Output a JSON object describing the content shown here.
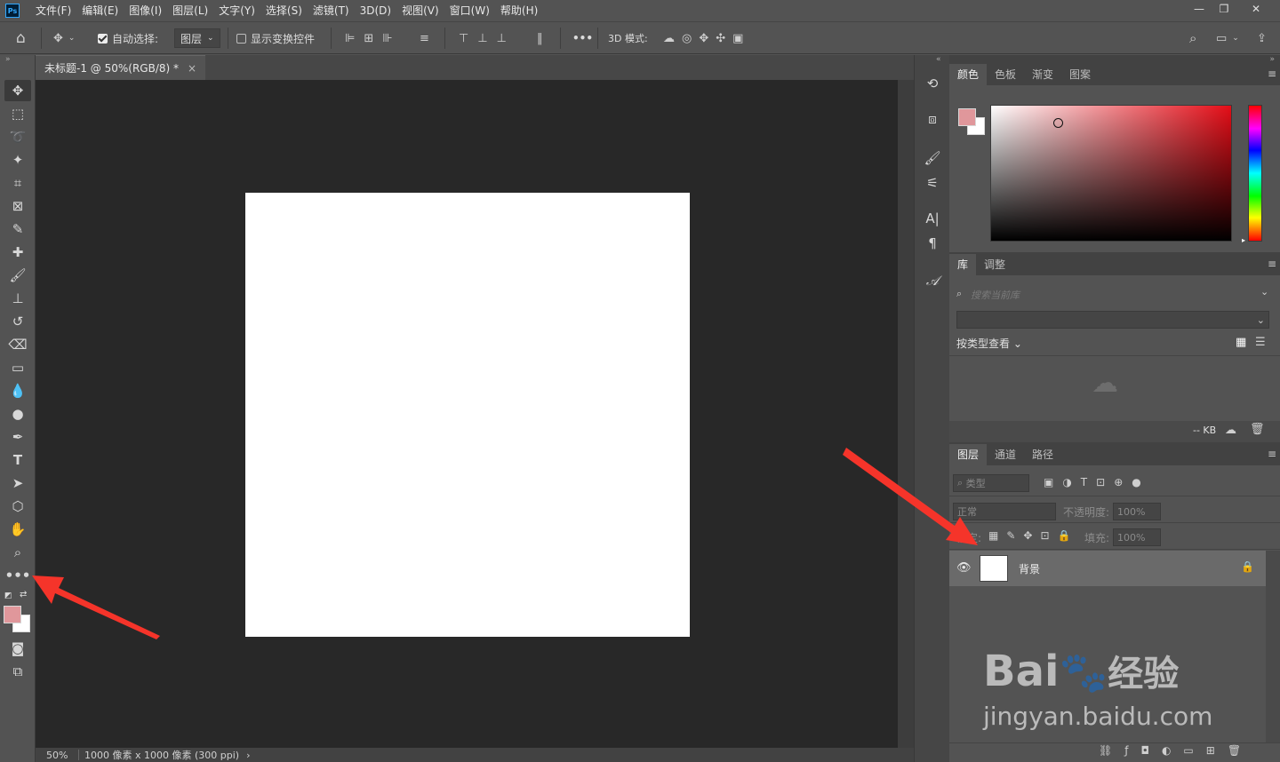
{
  "app": {
    "logo": "Ps"
  },
  "menubar": {
    "items": [
      "文件(F)",
      "编辑(E)",
      "图像(I)",
      "图层(L)",
      "文字(Y)",
      "选择(S)",
      "滤镜(T)",
      "3D(D)",
      "视图(V)",
      "窗口(W)",
      "帮助(H)"
    ]
  },
  "options_bar": {
    "auto_select_label": "自动选择:",
    "auto_select_value": "图层",
    "show_transform_label": "显示变换控件",
    "more_label": "•••",
    "mode_3d_label": "3D 模式:"
  },
  "document": {
    "tab_title": "未标题-1 @ 50%(RGB/8) *",
    "close_glyph": "×"
  },
  "status": {
    "zoom": "50%",
    "doc_info": "1000 像素 x 1000 像素 (300 ppi)",
    "arrow": "›"
  },
  "colors": {
    "foreground": "#e0979b",
    "background": "#ffffff",
    "arrow": "#f5342a"
  },
  "color_panel": {
    "tabs": [
      "颜色",
      "色板",
      "渐变",
      "图案"
    ]
  },
  "library_panel": {
    "tabs": [
      "库",
      "调整"
    ],
    "search_placeholder": "搜索当前库",
    "view_by_label": "按类型查看",
    "size_label": "-- KB"
  },
  "layers_panel": {
    "tabs": [
      "图层",
      "通道",
      "路径"
    ],
    "filter_label": "类型",
    "blend_mode": "正常",
    "opacity_label": "不透明度:",
    "opacity_value": "100%",
    "lock_label": "锁定:",
    "fill_label": "填充:",
    "fill_value": "100%",
    "layers": [
      {
        "name": "背景",
        "visible": true,
        "locked": true
      }
    ],
    "footer_icons": [
      "link-icon",
      "fx-icon",
      "mask-icon",
      "adjustment-icon",
      "folder-icon",
      "new-layer-icon",
      "trash-icon"
    ]
  },
  "watermark": {
    "brand": "Bai",
    "brand_suffix": "经验",
    "url": "jingyan.baidu.com"
  }
}
